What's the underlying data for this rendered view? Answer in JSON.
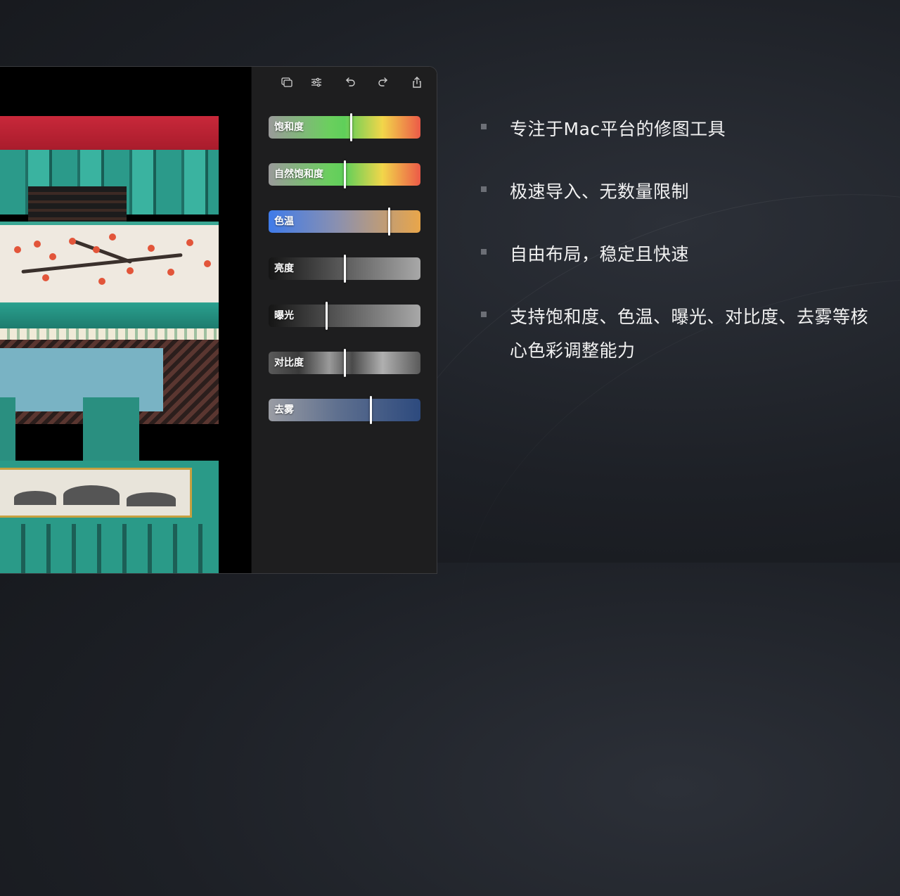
{
  "toolbar": {
    "icons": [
      "layers-icon",
      "adjustments-icon",
      "undo-icon",
      "redo-icon",
      "share-icon"
    ]
  },
  "sliders": [
    {
      "label": "饱和度",
      "value": 0.54
    },
    {
      "label": "自然饱和度",
      "value": 0.5
    },
    {
      "label": "色温",
      "value": 0.79
    },
    {
      "label": "亮度",
      "value": 0.5
    },
    {
      "label": "曝光",
      "value": 0.38
    },
    {
      "label": "对比度",
      "value": 0.5
    },
    {
      "label": "去雾",
      "value": 0.67
    }
  ],
  "colors": {
    "saturation": [
      "#9a9a9a",
      "#5fcf5a",
      "#f2d64a",
      "#ec5a48"
    ],
    "temperature": [
      "#3f7bea",
      "#e9a64a"
    ],
    "dehaze": [
      "#9a9ca3",
      "#2d4a7e"
    ]
  },
  "features": [
    "专注于Mac平台的修图工具",
    "极速导入、无数量限制",
    "自由布局，稳定且快速",
    "支持饱和度、色温、曝光、对比度、去雾等核心色彩调整能力"
  ]
}
